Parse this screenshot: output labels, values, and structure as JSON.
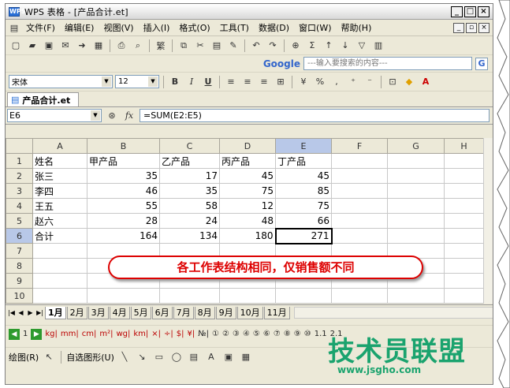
{
  "window": {
    "title": "WPS 表格 - [产品合计.et]",
    "app_icon": "WPS"
  },
  "menu": [
    "文件(F)",
    "编辑(E)",
    "视图(V)",
    "插入(I)",
    "格式(O)",
    "工具(T)",
    "数据(D)",
    "窗口(W)",
    "帮助(H)"
  ],
  "google": {
    "logo": "Google",
    "placeholder": "---输入要搜索的内容---",
    "button": "G"
  },
  "format": {
    "font": "宋体",
    "size": "12",
    "bold": "B",
    "italic": "I",
    "underline": "U"
  },
  "doc_tab": "产品合计.et",
  "namebox": "E6",
  "fx_label": "fx",
  "formula": "=SUM(E2:E5)",
  "columns": [
    "A",
    "B",
    "C",
    "D",
    "E",
    "F",
    "G",
    "H"
  ],
  "rows": [
    [
      "姓名",
      "甲产品",
      "乙产品",
      "丙产品",
      "丁产品",
      "",
      "",
      ""
    ],
    [
      "张三",
      "35",
      "17",
      "45",
      "45",
      "",
      "",
      ""
    ],
    [
      "李四",
      "46",
      "35",
      "75",
      "85",
      "",
      "",
      ""
    ],
    [
      "王五",
      "55",
      "58",
      "12",
      "75",
      "",
      "",
      ""
    ],
    [
      "赵六",
      "28",
      "24",
      "48",
      "66",
      "",
      "",
      ""
    ],
    [
      "合计",
      "164",
      "134",
      "180",
      "271",
      "",
      "",
      ""
    ],
    [
      "",
      "",
      "",
      "",
      "",
      "",
      "",
      ""
    ],
    [
      "",
      "",
      "",
      "",
      "",
      "",
      "",
      ""
    ],
    [
      "",
      "",
      "",
      "",
      "",
      "",
      "",
      ""
    ],
    [
      "",
      "",
      "",
      "",
      "",
      "",
      "",
      ""
    ]
  ],
  "annotation": "各工作表结构相同，仅销售额不同",
  "sheet_tabs": [
    "1月",
    "2月",
    "3月",
    "4月",
    "5月",
    "6月",
    "7月",
    "8月",
    "9月",
    "10月",
    "11月"
  ],
  "symbols": [
    "kg|",
    "mm|",
    "cm|",
    "m²|",
    "wg|",
    "km|",
    "×|",
    "÷|",
    "$|",
    "¥|"
  ],
  "num_symbols": [
    "№|",
    "①",
    "②",
    "③",
    "④",
    "⑤",
    "⑥",
    "⑦",
    "⑧",
    "⑨",
    "⑩",
    "1.1",
    "2.1"
  ],
  "draw": {
    "draw_label": "绘图(R)",
    "autoshape_label": "自选图形(U)"
  },
  "watermark": {
    "text": "技术员联盟",
    "url": "www.jsgho.com"
  }
}
